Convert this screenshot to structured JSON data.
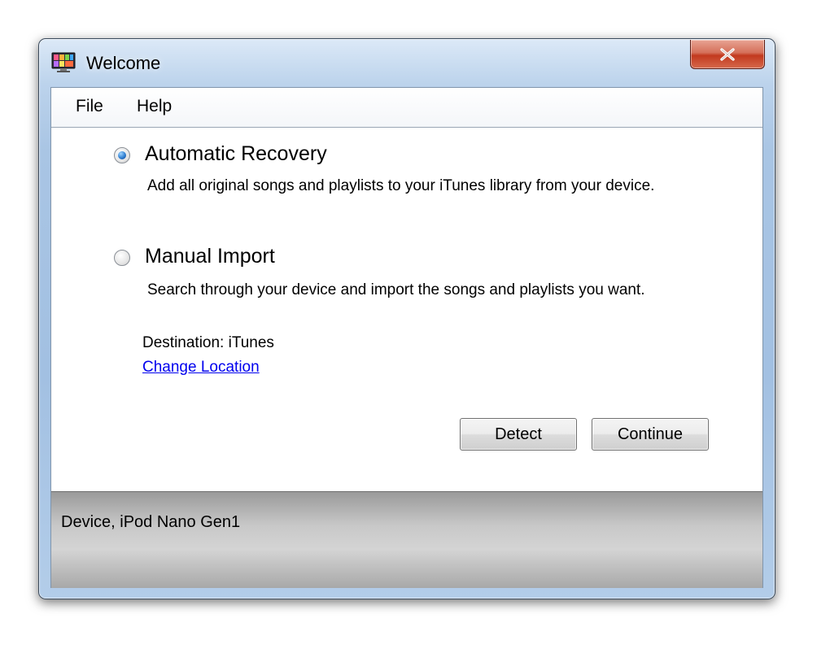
{
  "window": {
    "title": "Welcome",
    "close_glyph": "✕"
  },
  "menu": {
    "items": [
      {
        "label": "File"
      },
      {
        "label": "Help"
      }
    ]
  },
  "options": [
    {
      "title": "Automatic Recovery",
      "description": "Add all original songs and playlists to your iTunes library from your device.",
      "selected": true
    },
    {
      "title": "Manual Import",
      "description": "Search through your device and import the songs and playlists you want.",
      "selected": false
    }
  ],
  "destination": {
    "text": "Destination: iTunes",
    "change_link": "Change Location"
  },
  "buttons": {
    "detect": "Detect",
    "continue": "Continue"
  },
  "status": {
    "text": "Device, iPod Nano Gen1"
  },
  "colors": {
    "link": "#0000ee",
    "radio_selected": "#2f7fd1",
    "close_button": "#c2391f"
  },
  "icons": {
    "app": "itunes-app-icon",
    "close": "close-icon"
  }
}
